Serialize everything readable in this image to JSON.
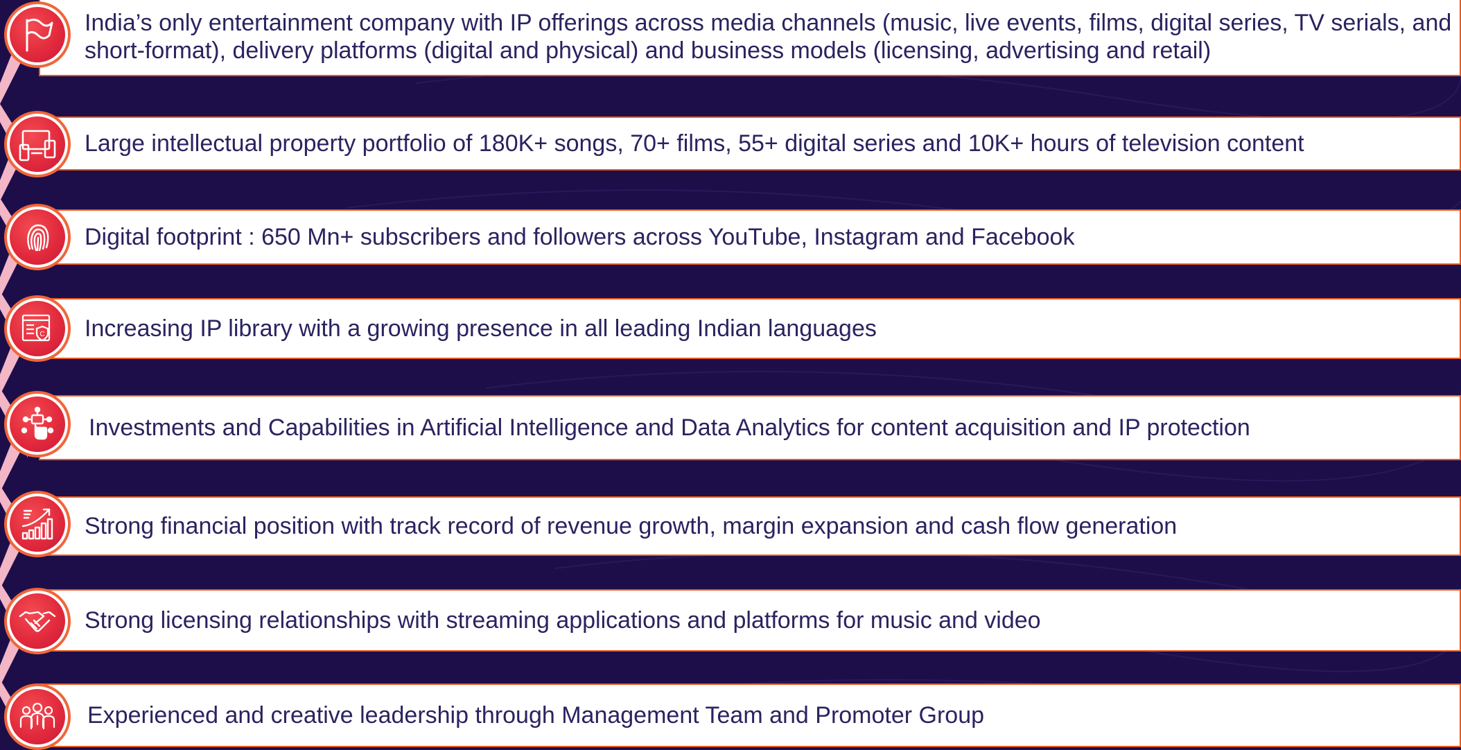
{
  "colors": {
    "background": "#1d0e4a",
    "box_border": "#e85a1e",
    "text": "#2a2360",
    "icon_fill": "#e22a3c"
  },
  "highlights": [
    {
      "icon": "flag-icon",
      "text": "India’s only entertainment company with IP offerings across media channels (music, live events, films, digital series, TV serials, and short-format), delivery platforms (digital and physical) and business models (licensing, advertising and retail)"
    },
    {
      "icon": "devices-icon",
      "text": "Large intellectual property portfolio of 180K+ songs, 70+ films, 55+ digital series and 10K+ hours of television content"
    },
    {
      "icon": "fingerprint-icon",
      "text": "Digital footprint : 650 Mn+ subscribers and followers across YouTube, Instagram and Facebook"
    },
    {
      "icon": "ip-library-icon",
      "text": "Increasing IP library with a growing presence in all leading Indian languages"
    },
    {
      "icon": "ai-network-icon",
      "text": "Investments and Capabilities in Artificial Intelligence and Data Analytics for content acquisition and IP protection"
    },
    {
      "icon": "growth-chart-icon",
      "text": "Strong financial position with track record of revenue growth, margin expansion and cash flow generation"
    },
    {
      "icon": "handshake-icon",
      "text": "Strong licensing relationships with streaming applications and platforms for music and video"
    },
    {
      "icon": "team-icon",
      "text": "Experienced and creative leadership through Management Team and Promoter Group"
    }
  ]
}
